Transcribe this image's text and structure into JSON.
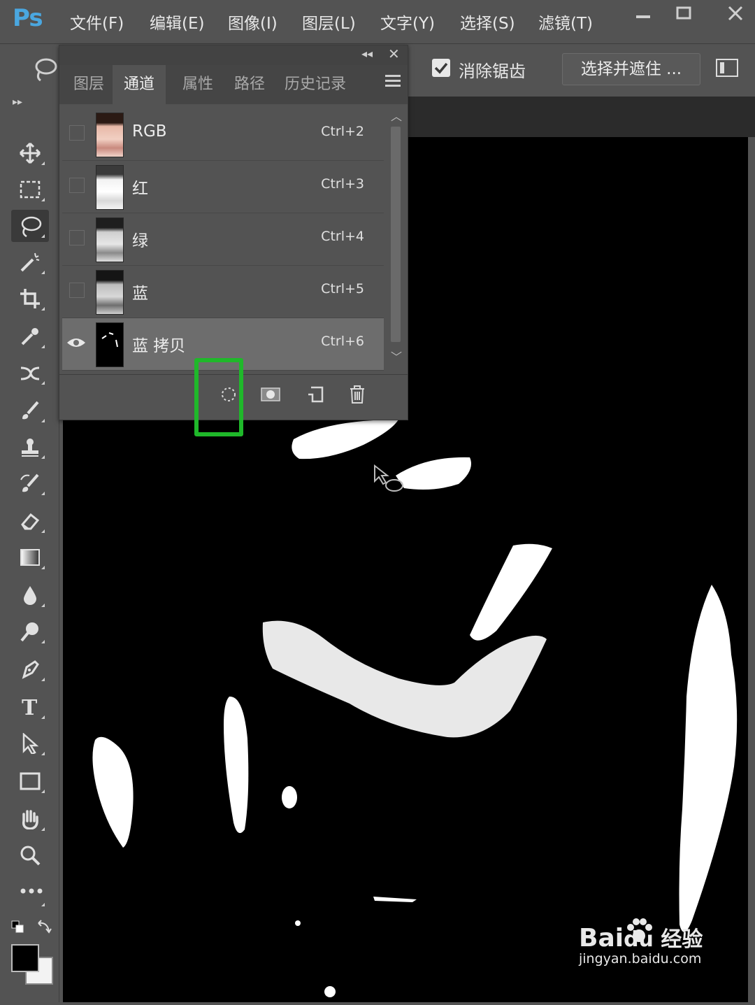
{
  "app": {
    "logo": "Ps"
  },
  "menubar": {
    "items": [
      "文件(F)",
      "编辑(E)",
      "图像(I)",
      "图层(L)",
      "文字(Y)",
      "选择(S)",
      "滤镜(T)"
    ],
    "window_buttons": [
      "minimize-icon",
      "restore-icon",
      "close-icon"
    ]
  },
  "options_bar": {
    "tool_icon": "lasso-icon",
    "antialias_label": "消除锯齿",
    "antialias_checked": true,
    "select_mask_label": "选择并遮住 ..."
  },
  "tools": [
    "move-icon",
    "marquee-icon",
    "lasso-icon",
    "magic-wand-icon",
    "crop-icon",
    "eyedropper-icon",
    "healing-icon",
    "brush-icon",
    "stamp-icon",
    "history-brush-icon",
    "eraser-icon",
    "gradient-icon",
    "blur-icon",
    "dodge-icon",
    "pen-icon",
    "type-icon",
    "path-selection-icon",
    "rectangle-icon",
    "hand-icon",
    "zoom-icon",
    "more-icon"
  ],
  "active_tool": "lasso-icon",
  "colors": {
    "foreground": "#000000",
    "background": "#f3f3f3",
    "highlight": "#1fb82a"
  },
  "channels_panel": {
    "tabs": [
      "图层",
      "通道",
      "属性",
      "路径",
      "历史记录"
    ],
    "active_tab": "通道",
    "channels": [
      {
        "name": "RGB",
        "shortcut": "Ctrl+2",
        "visible": false,
        "selected": false
      },
      {
        "name": "红",
        "shortcut": "Ctrl+3",
        "visible": false,
        "selected": false
      },
      {
        "name": "绿",
        "shortcut": "Ctrl+4",
        "visible": false,
        "selected": false
      },
      {
        "name": "蓝",
        "shortcut": "Ctrl+5",
        "visible": false,
        "selected": false
      },
      {
        "name": "蓝 拷贝",
        "shortcut": "Ctrl+6",
        "visible": true,
        "selected": true
      }
    ],
    "bottom_buttons": [
      "load-channel-as-selection-icon",
      "save-selection-as-channel-icon",
      "new-channel-icon",
      "delete-channel-icon"
    ],
    "highlighted_button": "load-channel-as-selection-icon"
  },
  "watermark": {
    "brand": "Bai",
    "brand_suffix": "du 经验",
    "url": "jingyan.baidu.com"
  }
}
